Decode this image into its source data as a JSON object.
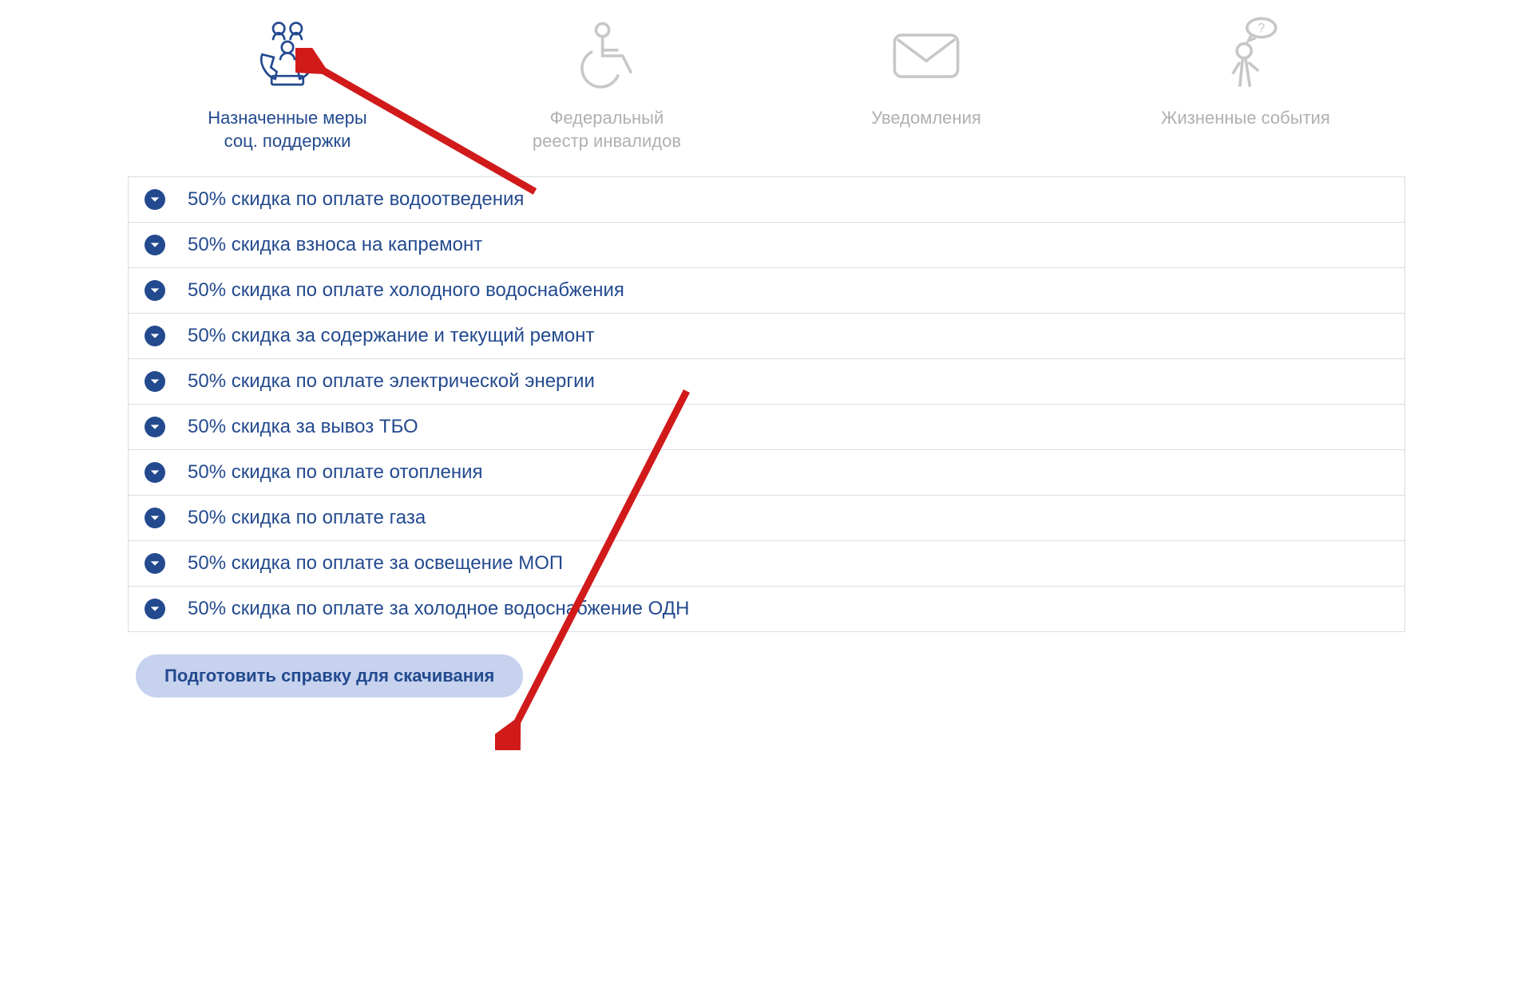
{
  "tabs": [
    {
      "label_line1": "Назначенные меры",
      "label_line2": "соц. поддержки",
      "active": true
    },
    {
      "label_line1": "Федеральный",
      "label_line2": "реестр инвалидов",
      "active": false
    },
    {
      "label_line1": "Уведомления",
      "label_line2": "",
      "active": false
    },
    {
      "label_line1": "Жизненные события",
      "label_line2": "",
      "active": false
    }
  ],
  "list": {
    "items": [
      {
        "label": "50% скидка по оплате водоотведения"
      },
      {
        "label": "50% скидка взноса на капремонт"
      },
      {
        "label": "50% скидка по оплате холодного водоснабжения"
      },
      {
        "label": "50% скидка за содержание и текущий ремонт"
      },
      {
        "label": "50% скидка по оплате электрической энергии"
      },
      {
        "label": "50% скидка за вывоз ТБО"
      },
      {
        "label": "50% скидка по оплате отопления"
      },
      {
        "label": "50% скидка по оплате газа"
      },
      {
        "label": "50% скидка по оплате за освещение МОП"
      },
      {
        "label": "50% скидка по оплате за холодное водоснабжение ОДН"
      }
    ]
  },
  "actions": {
    "prepare_label": "Подготовить справку для скачивания"
  },
  "colors": {
    "primary": "#234a8f",
    "inactive": "#b0b0b0",
    "button_bg": "#c6d2ee",
    "border": "#d9dde4",
    "arrow": "#d11a1a"
  }
}
